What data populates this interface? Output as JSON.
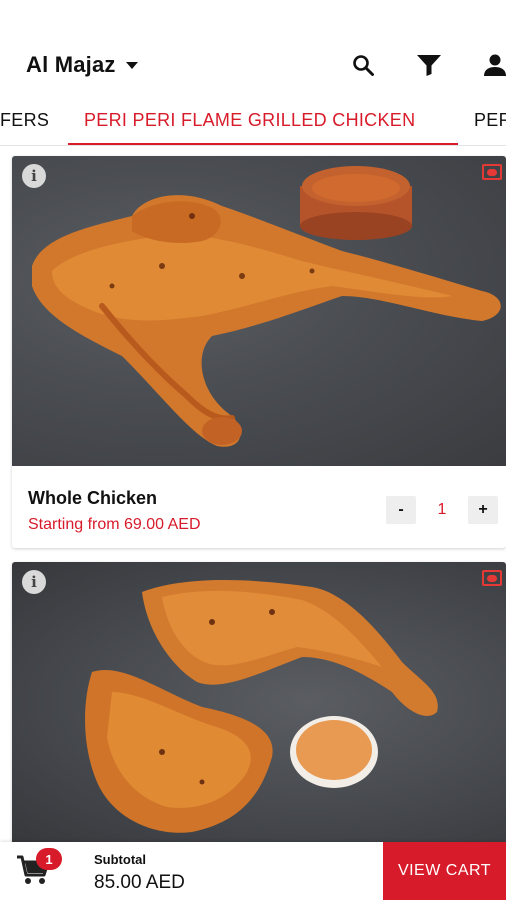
{
  "header": {
    "location": "Al Majaz",
    "icons": [
      "search-icon",
      "filter-icon",
      "account-icon"
    ]
  },
  "tabs": {
    "left_partial": "FERS",
    "active": "PERI PERI FLAME GRILLED CHICKEN",
    "right_partial": "PER"
  },
  "products": [
    {
      "name": "Whole Chicken",
      "price": "Starting from 69.00 AED",
      "quantity": "1",
      "minus": "-",
      "plus": "+",
      "info": "i"
    },
    {
      "info": "i"
    }
  ],
  "cart": {
    "count": "1",
    "subtotal_label": "Subtotal",
    "subtotal_value": "85.00 AED",
    "view_cart_label": "VIEW CART"
  },
  "colors": {
    "accent": "#d81b2a",
    "badge": "#e53935"
  }
}
